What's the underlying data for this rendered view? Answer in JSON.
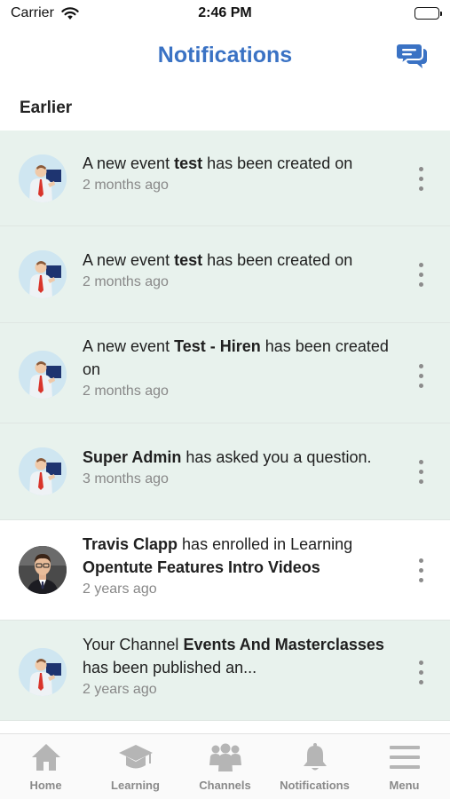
{
  "status_bar": {
    "carrier": "Carrier",
    "time": "2:46 PM"
  },
  "header": {
    "title": "Notifications",
    "chat_icon": "chat-bubbles-icon"
  },
  "section_label": "Earlier",
  "notifications": [
    {
      "avatar": "illustration-avatar",
      "text_before": "A new event ",
      "bold": "test",
      "text_after": " has been created on",
      "bold2": "",
      "text_after2": "",
      "time": "2 months ago",
      "unread": true
    },
    {
      "avatar": "illustration-avatar",
      "text_before": "A new event ",
      "bold": "test",
      "text_after": " has been created on",
      "bold2": "",
      "text_after2": "",
      "time": "2 months ago",
      "unread": true
    },
    {
      "avatar": "illustration-avatar",
      "text_before": "A new event ",
      "bold": "Test - Hiren",
      "text_after": " has been created on",
      "bold2": "",
      "text_after2": "",
      "time": "2 months ago",
      "unread": true
    },
    {
      "avatar": "illustration-avatar",
      "text_before": "",
      "bold": "Super Admin",
      "text_after": " has asked you a question.",
      "bold2": "",
      "text_after2": "",
      "time": "3 months ago",
      "unread": true
    },
    {
      "avatar": "photo-avatar",
      "text_before": "",
      "bold": "Travis Clapp",
      "text_after": " has enrolled in Learning ",
      "bold2": "Opentute Features Intro Videos",
      "text_after2": "",
      "time": "2 years ago",
      "unread": false
    },
    {
      "avatar": "illustration-avatar",
      "text_before": "Your Channel ",
      "bold": "Events And Masterclasses",
      "text_after": " has been published an...",
      "bold2": "",
      "text_after2": "",
      "time": "2 years ago",
      "unread": true
    }
  ],
  "tabs": [
    {
      "label": "Home",
      "icon": "home-icon"
    },
    {
      "label": "Learning",
      "icon": "graduation-cap-icon"
    },
    {
      "label": "Channels",
      "icon": "users-group-icon"
    },
    {
      "label": "Notifications",
      "icon": "bell-icon"
    },
    {
      "label": "Menu",
      "icon": "hamburger-menu-icon"
    }
  ],
  "colors": {
    "accent": "#3a72c4",
    "unread_bg": "#e8f2ed",
    "tab_icon": "#b5b5b5",
    "muted_text": "#888888"
  }
}
